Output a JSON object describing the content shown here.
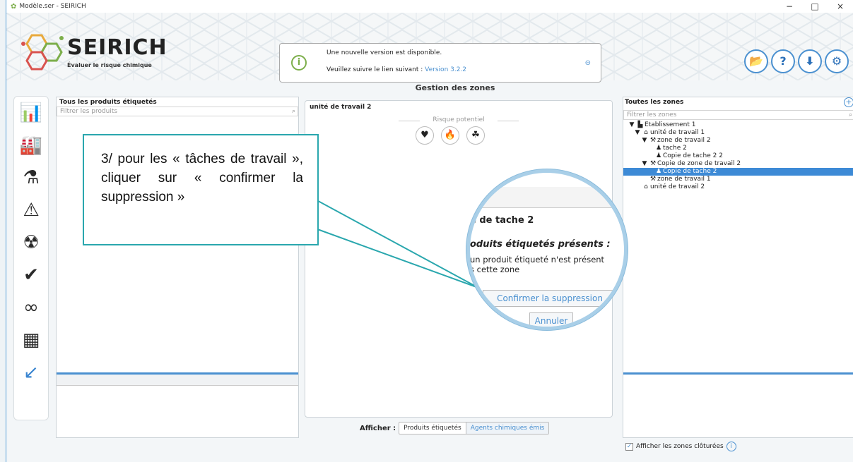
{
  "window": {
    "title": "Modèle.ser - SEIRICH",
    "controls": [
      "−",
      "□",
      "×"
    ]
  },
  "logo": {
    "name": "SEIRICH",
    "tagline": "Évaluer le risque chimique"
  },
  "notice": {
    "line1": "Une nouvelle version est disponible.",
    "line2_prefix": "Veuillez suivre le lien suivant : ",
    "link": "Version 3.2.2"
  },
  "header_buttons": [
    {
      "icon": "folder-open-icon",
      "glyph": "📂"
    },
    {
      "icon": "help-icon",
      "glyph": "?"
    },
    {
      "icon": "download-icon",
      "glyph": "⬇"
    },
    {
      "icon": "settings-icon",
      "glyph": "⚙"
    }
  ],
  "main_title": "Gestion des zones",
  "left_panel": {
    "title": "Tous les produits étiquetés",
    "search_placeholder": "Filtrer les produits"
  },
  "center_panel": {
    "title": "unité de travail 2",
    "risk_label": "Risque potentiel"
  },
  "right_panel": {
    "title": "Toutes les zones",
    "search_placeholder": "Filtrer les zones",
    "tree": [
      {
        "label": "Etablissement 1",
        "level": 0,
        "toggle": "▼",
        "icon": "factory-icon"
      },
      {
        "label": "unité de travail 1",
        "level": 1,
        "toggle": "▼",
        "icon": "home-icon"
      },
      {
        "label": "zone de travail 2",
        "level": 2,
        "toggle": "▼",
        "icon": "tools-icon"
      },
      {
        "label": "tache 2",
        "level": 3,
        "toggle": "",
        "icon": "user-icon"
      },
      {
        "label": "Copie de tache 2 2",
        "level": 3,
        "toggle": "",
        "icon": "user-icon"
      },
      {
        "label": "Copie de zone de travail 2",
        "level": 2,
        "toggle": "▼",
        "icon": "tools-icon"
      },
      {
        "label": "Copie de tache 2",
        "level": 3,
        "toggle": "",
        "icon": "user-icon",
        "selected": true
      },
      {
        "label": "zone de travail 1",
        "level": 2,
        "toggle": "",
        "icon": "tools-icon"
      },
      {
        "label": "unité de travail 2",
        "level": 1,
        "toggle": "",
        "icon": "home-icon"
      }
    ]
  },
  "bottom": {
    "afficher_label": "Afficher :",
    "option_a": "Produits étiquetés",
    "option_b": "Agents chimiques émis",
    "checkbox_label": "Afficher les zones clôturées",
    "checkbox_checked": true
  },
  "callout": {
    "text": "3/ pour les « tâches de travail », cliquer sur « confirmer la suppression »"
  },
  "magnifier": {
    "heading": "e de tache 2",
    "subheading": "oduits étiquetés présents :",
    "paragraph_line1": "un produit étiqueté n'est présent",
    "paragraph_line2": "s cette zone",
    "confirm_button": "Confirmer la suppression",
    "cancel_button": "Annuler"
  },
  "colors": {
    "accent": "#4a90d0",
    "callout_border": "#2aa7ae",
    "selected_row": "#3d8ad6",
    "brand_green": "#7cae4a"
  }
}
